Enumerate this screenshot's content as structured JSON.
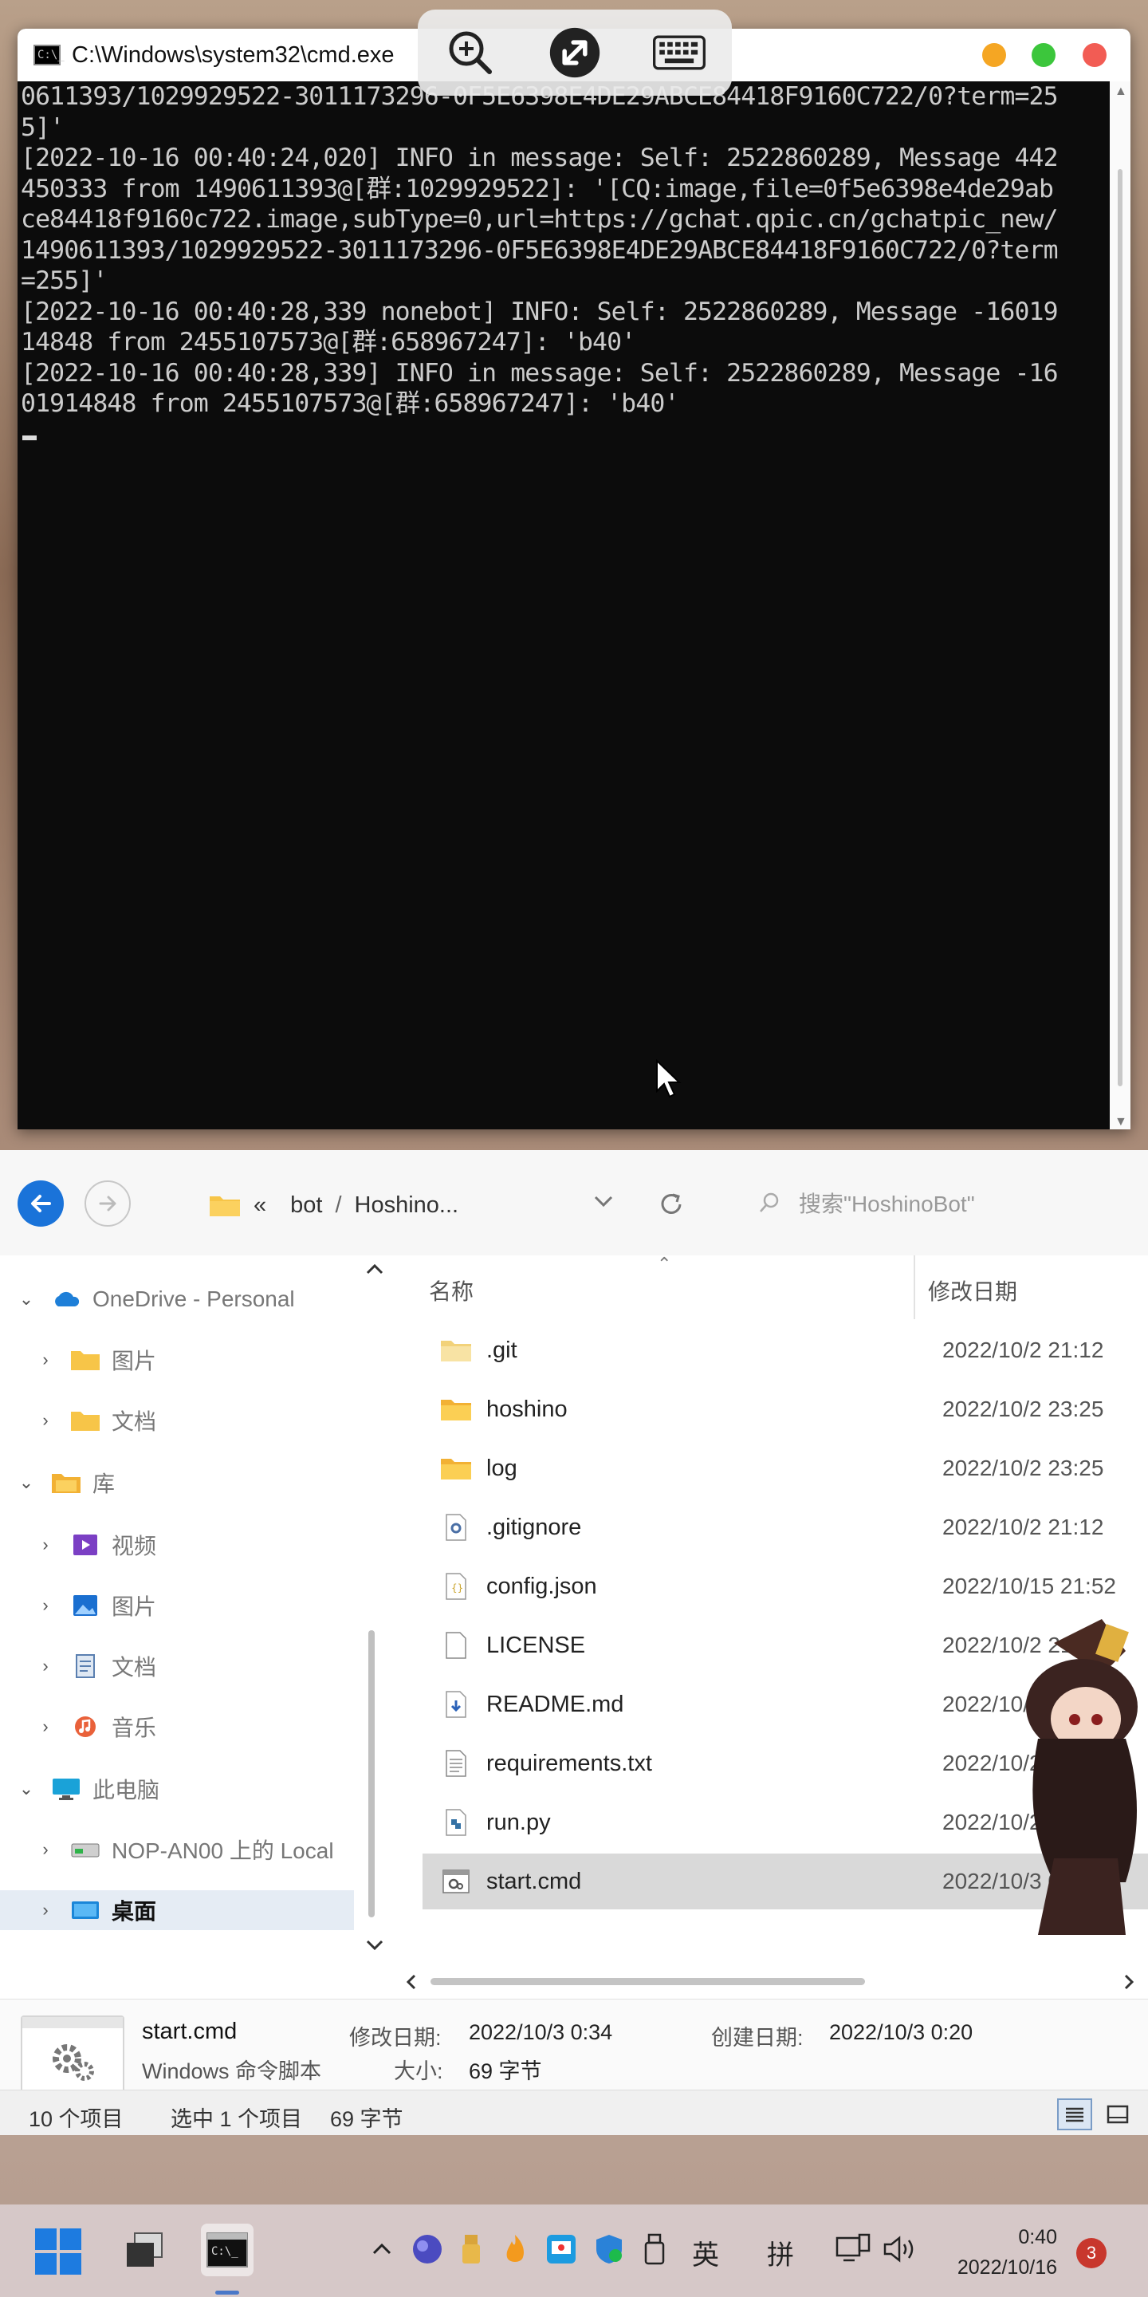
{
  "cmd": {
    "title": "C:\\Windows\\system32\\cmd.exe",
    "lines": [
      "0611393/1029929522-3011173296-0F5E6398E4DE29ABCE84418F9160C722/0?term=25",
      "5]'",
      "[2022-10-16 00:40:24,020] INFO in message: Self: 2522860289, Message 442",
      "450333 from 1490611393@[群:1029929522]: '[CQ:image,file=0f5e6398e4de29ab",
      "ce84418f9160c722.image,subType=0,url=https://gchat.qpic.cn/gchatpic_new/",
      "1490611393/1029929522-3011173296-0F5E6398E4DE29ABCE84418F9160C722/0?term",
      "=255]'",
      "[2022-10-16 00:40:28,339 nonebot] INFO: Self: 2522860289, Message -16019",
      "14848 from 2455107573@[群:658967247]: 'b40'",
      "[2022-10-16 00:40:28,339] INFO in message: Self: 2522860289, Message -16",
      "01914848 from 2455107573@[群:658967247]: 'b40'"
    ]
  },
  "remote_toolbar": {
    "icons": [
      "zoom-in-icon",
      "remote-desktop-icon",
      "keyboard-icon"
    ]
  },
  "explorer": {
    "breadcrumb": {
      "overflow": "«",
      "parts": [
        "bot",
        "Hoshino..."
      ],
      "separator": "/"
    },
    "search_placeholder": "搜索\"HoshinoBot\"",
    "nav": [
      {
        "label": "OneDrive - Personal",
        "icon": "cloud-icon",
        "expanded": true
      },
      {
        "label": "图片",
        "icon": "folder-icon",
        "expanded": false
      },
      {
        "label": "文档",
        "icon": "folder-icon",
        "expanded": false
      },
      {
        "label": "库",
        "icon": "library-icon",
        "expanded": true
      },
      {
        "label": "视频",
        "icon": "video-icon",
        "expanded": false
      },
      {
        "label": "图片",
        "icon": "picture-icon",
        "expanded": false
      },
      {
        "label": "文档",
        "icon": "document-icon",
        "expanded": false
      },
      {
        "label": "音乐",
        "icon": "music-icon",
        "expanded": false
      },
      {
        "label": "此电脑",
        "icon": "computer-icon",
        "expanded": true
      },
      {
        "label": "NOP-AN00 上的 Local",
        "icon": "phone-drive-icon",
        "expanded": false
      },
      {
        "label": "桌面",
        "icon": "desktop-icon",
        "expanded": false
      }
    ],
    "columns": {
      "name": "名称",
      "modified": "修改日期"
    },
    "files": [
      {
        "name": ".git",
        "date": "2022/10/2 21:12",
        "icon": "folder-icon"
      },
      {
        "name": "hoshino",
        "date": "2022/10/2 23:25",
        "icon": "folder-icon"
      },
      {
        "name": "log",
        "date": "2022/10/2 23:25",
        "icon": "folder-icon"
      },
      {
        "name": ".gitignore",
        "date": "2022/10/2 21:12",
        "icon": "settings-file-icon"
      },
      {
        "name": "config.json",
        "date": "2022/10/15 21:52",
        "icon": "json-file-icon"
      },
      {
        "name": "LICENSE",
        "date": "2022/10/2 21:12",
        "icon": "blank-file-icon"
      },
      {
        "name": "README.md",
        "date": "2022/10/2 21:12",
        "icon": "markdown-file-icon"
      },
      {
        "name": "requirements.txt",
        "date": "2022/10/2 21:12",
        "icon": "text-file-icon"
      },
      {
        "name": "run.py",
        "date": "2022/10/2 21:12",
        "icon": "python-file-icon"
      },
      {
        "name": "start.cmd",
        "date": "2022/10/3 0:34",
        "icon": "cmd-file-icon",
        "selected": true
      }
    ],
    "details": {
      "name": "start.cmd",
      "type": "Windows 命令脚本",
      "modified_label": "修改日期:",
      "modified_value": "2022/10/3 0:34",
      "created_label": "创建日期:",
      "created_value": "2022/10/3 0:20",
      "size_label": "大小:",
      "size_value": "69 字节"
    },
    "status": {
      "count": "10 个项目",
      "selected": "选中 1 个项目",
      "size": "69 字节"
    }
  },
  "taskbar": {
    "tray": {
      "lang1": "英",
      "lang2": "拼"
    },
    "time": "0:40",
    "date": "2022/10/16",
    "notifications": "3"
  }
}
